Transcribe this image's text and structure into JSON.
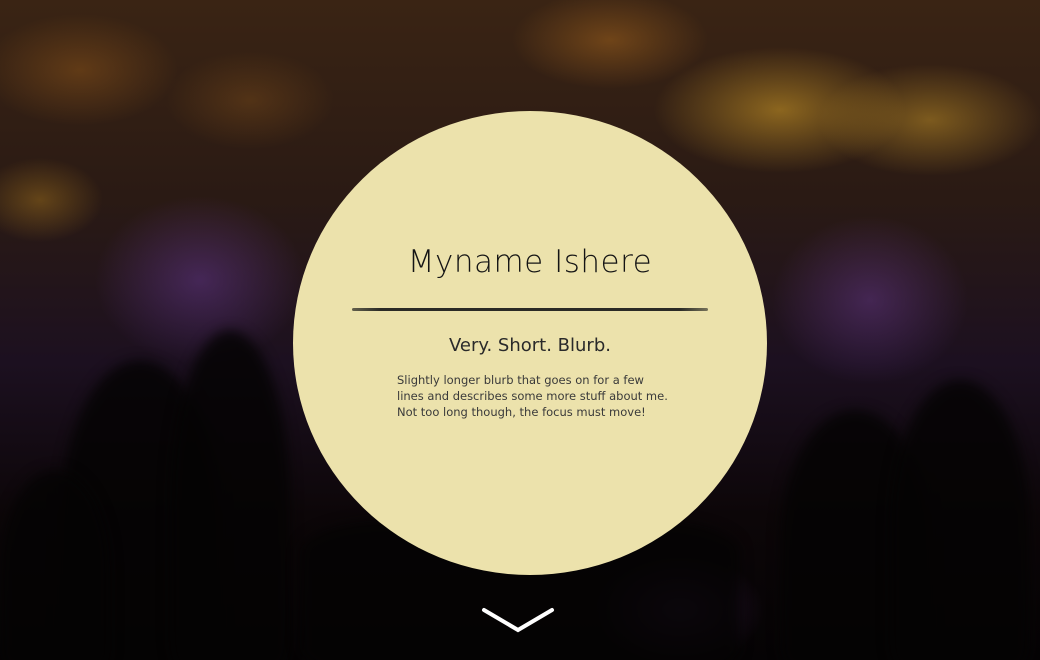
{
  "profile": {
    "name": "Myname Ishere",
    "short_blurb": "Very. Short. Blurb.",
    "long_blurb_lines": [
      "Slightly longer blurb that goes on for a few",
      "lines and describes some more stuff about me.",
      "Not too long though, the focus must move!"
    ]
  },
  "colors": {
    "circle": "#ece2ac",
    "text": "#141414",
    "chevron": "#ffffff"
  },
  "icons": {
    "scroll": "chevron-down-icon"
  }
}
